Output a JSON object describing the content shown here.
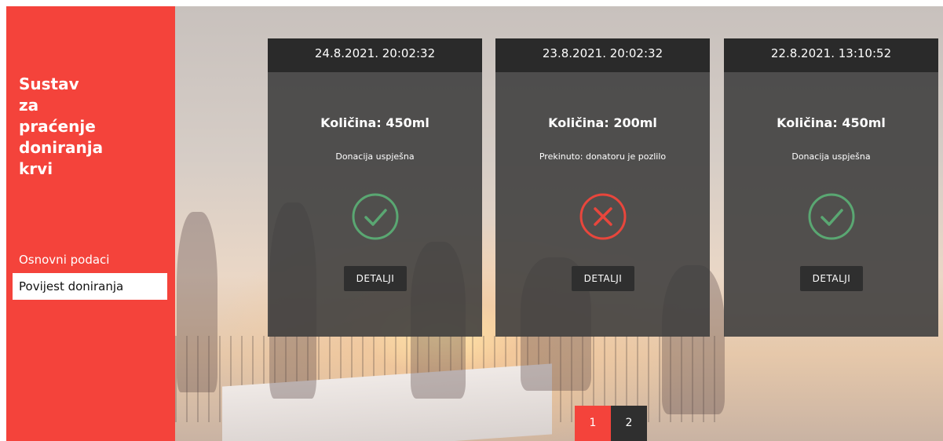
{
  "sidebar": {
    "title_lines": [
      "Sustav",
      "za",
      "praćenje",
      "doniranja",
      "krvi"
    ],
    "nav": [
      {
        "label": "Osnovni podaci",
        "active": false
      },
      {
        "label": "Povijest doniranja",
        "active": true
      }
    ]
  },
  "donations": [
    {
      "datetime": "24.8.2021. 20:02:32",
      "amount": "Količina: 450ml",
      "status": "Donacija uspješna",
      "icon": "check-circle-icon",
      "button": "DETALJI"
    },
    {
      "datetime": "23.8.2021. 20:02:32",
      "amount": "Količina: 200ml",
      "status": "Prekinuto: donatoru je pozlilo",
      "icon": "x-circle-icon",
      "button": "DETALJI"
    },
    {
      "datetime": "22.8.2021. 13:10:52",
      "amount": "Količina: 450ml",
      "status": "Donacija uspješna",
      "icon": "check-circle-icon",
      "button": "DETALJI"
    }
  ],
  "pagination": {
    "pages": [
      "1",
      "2"
    ],
    "current": "1"
  },
  "colors": {
    "accent": "#f4433b",
    "success": "#5aa772",
    "error": "#e8463c",
    "card_bg": "#3c3c3c"
  }
}
